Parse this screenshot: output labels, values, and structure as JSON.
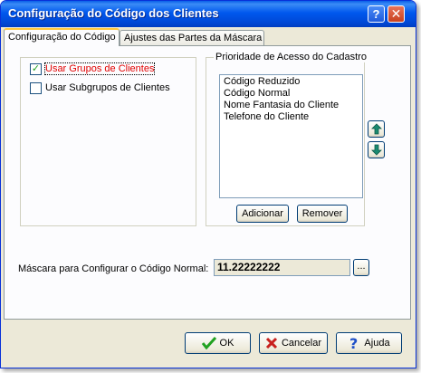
{
  "window": {
    "title": "Configuração do Código dos Clientes",
    "help_symbol": "?",
    "close_symbol": "✕"
  },
  "tabs": [
    {
      "label": "Configuração do Código",
      "active": true
    },
    {
      "label": "Ajustes das Partes da Máscara",
      "active": false
    }
  ],
  "options": {
    "usar_grupos": {
      "label": "Usar Grupos de Clientes",
      "checked": true
    },
    "usar_subgrupos": {
      "label": "Usar Subgrupos de Clientes",
      "checked": false
    }
  },
  "priority": {
    "title": "Prioridade de Acesso do Cadastro",
    "items": [
      "Código Reduzido",
      "Código Normal",
      "Nome Fantasia do Cliente",
      "Telefone do Cliente"
    ],
    "add_label": "Adicionar",
    "remove_label": "Remover"
  },
  "mask": {
    "label": "Máscara para Configurar o Código Normal:",
    "value": "11.22222222",
    "browse_label": "..."
  },
  "footer": {
    "ok_label": "OK",
    "cancel_label": "Cancelar",
    "help_label": "Ajuda"
  },
  "colors": {
    "titlebar": "#0058ee",
    "arrow": "#1a8a70",
    "ok_check": "#21a121",
    "cancel_x": "#c8201e",
    "help_q": "#1f50c8",
    "focus_text": "#e00000"
  }
}
